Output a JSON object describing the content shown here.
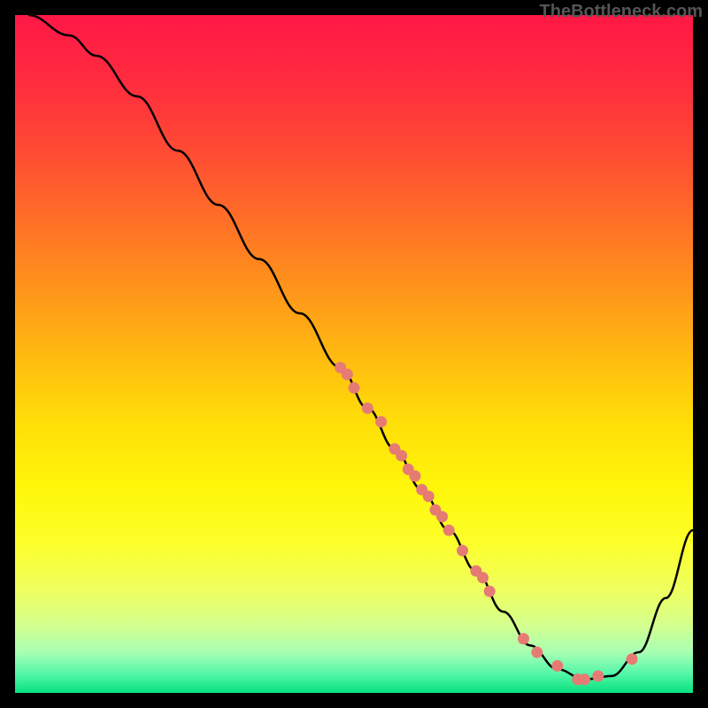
{
  "watermark": "TheBottleneck.com",
  "chart_data": {
    "type": "line",
    "title": "",
    "xlabel": "",
    "ylabel": "",
    "ylim": [
      0,
      100
    ],
    "xlim": [
      0,
      100
    ],
    "series": [
      {
        "name": "curve",
        "x": [
          2,
          8,
          12,
          18,
          24,
          30,
          36,
          42,
          48,
          52,
          56,
          60,
          64,
          68,
          72,
          76,
          80,
          84,
          88,
          92,
          96,
          100
        ],
        "y": [
          100,
          97,
          94,
          88,
          80,
          72,
          64,
          56,
          48,
          42,
          36,
          30,
          24,
          18,
          12,
          7,
          3.5,
          2,
          2.5,
          6,
          14,
          24
        ]
      }
    ],
    "scatter": {
      "name": "points",
      "color": "#e67b74",
      "x": [
        48,
        49,
        50,
        52,
        54,
        56,
        57,
        58,
        59,
        60,
        61,
        62,
        63,
        64,
        66,
        68,
        69,
        70,
        75,
        77,
        80,
        83,
        84,
        86,
        91
      ],
      "y": [
        48,
        47,
        45,
        42,
        40,
        36,
        35,
        33,
        32,
        30,
        29,
        27,
        26,
        24,
        21,
        18,
        17,
        15,
        8,
        6,
        4,
        2,
        2,
        2.5,
        5
      ]
    },
    "gradient_stops": [
      {
        "offset": 0.0,
        "color": "#ff1846"
      },
      {
        "offset": 0.1,
        "color": "#ff2c3e"
      },
      {
        "offset": 0.2,
        "color": "#ff4b33"
      },
      {
        "offset": 0.3,
        "color": "#ff6e27"
      },
      {
        "offset": 0.4,
        "color": "#ff931b"
      },
      {
        "offset": 0.5,
        "color": "#ffb910"
      },
      {
        "offset": 0.6,
        "color": "#ffde08"
      },
      {
        "offset": 0.7,
        "color": "#fff70a"
      },
      {
        "offset": 0.78,
        "color": "#fcff2c"
      },
      {
        "offset": 0.85,
        "color": "#eeff60"
      },
      {
        "offset": 0.9,
        "color": "#d4ff8e"
      },
      {
        "offset": 0.94,
        "color": "#a8ffb4"
      },
      {
        "offset": 0.97,
        "color": "#58f7aa"
      },
      {
        "offset": 1.0,
        "color": "#07e17e"
      }
    ]
  }
}
